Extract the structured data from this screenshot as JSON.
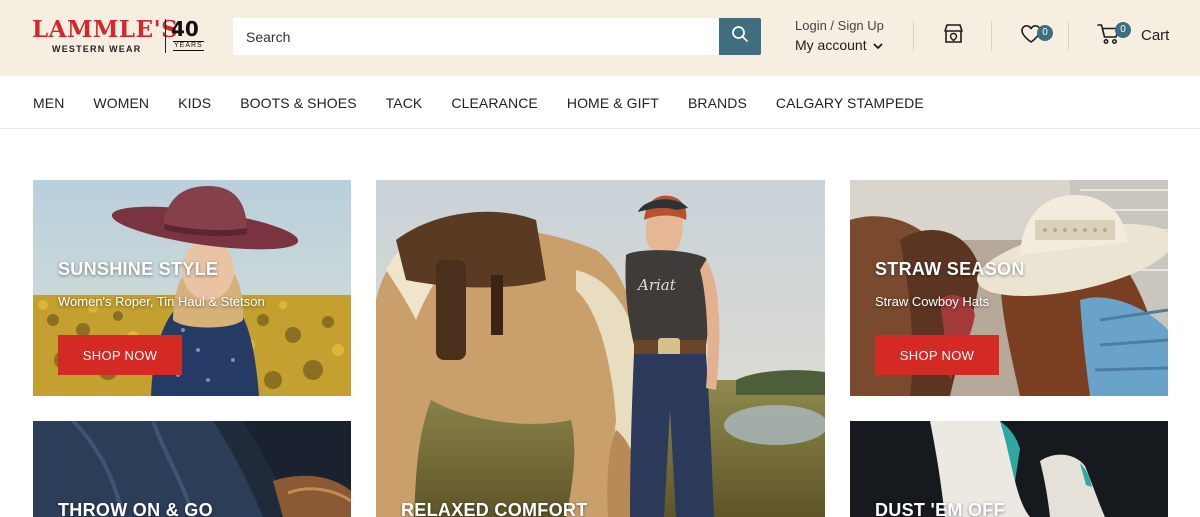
{
  "header": {
    "logo_name": "LAMMLE'S",
    "logo_sub": "WESTERN WEAR",
    "logo_years_num": "40",
    "logo_years_txt": "YEARS",
    "search_placeholder": "Search",
    "account_login": "Login / Sign Up",
    "account_my": "My account",
    "wishlist_count": "0",
    "cart_count": "0",
    "cart_label": "Cart"
  },
  "nav": {
    "items": [
      "MEN",
      "WOMEN",
      "KIDS",
      "BOOTS & SHOES",
      "TACK",
      "CLEARANCE",
      "HOME & GIFT",
      "BRANDS",
      "CALGARY STAMPEDE"
    ]
  },
  "tiles": {
    "sunshine": {
      "title": "SUNSHINE STYLE",
      "subtitle": "Women's Roper, Tin Haul & Stetson",
      "button": "SHOP NOW"
    },
    "straw": {
      "title": "STRAW SEASON",
      "subtitle": "Straw Cowboy Hats",
      "button": "SHOP NOW"
    },
    "throw": {
      "title": "THROW ON & GO"
    },
    "relaxed": {
      "title": "RELAXED COMFORT"
    },
    "dust": {
      "title": "DUST 'EM OFF"
    }
  },
  "colors": {
    "header_bg": "#f6efe1",
    "brand_red": "#d4262c",
    "accent_teal": "#3e6e80",
    "button_red": "#d42a23"
  },
  "icons": [
    "search-icon",
    "chevron-down-icon",
    "store-icon",
    "heart-icon",
    "cart-icon"
  ]
}
